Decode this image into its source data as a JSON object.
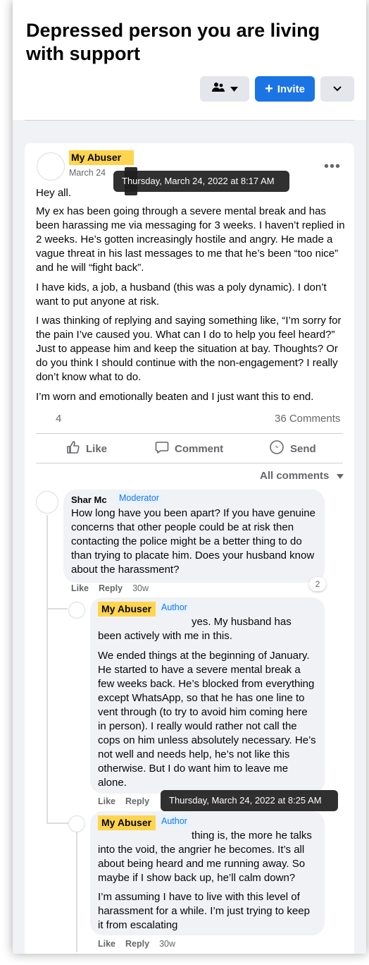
{
  "group": {
    "title": "Depressed person you are living with support",
    "invite_label": "Invite"
  },
  "post": {
    "author": "My Abuser",
    "date": "March 24",
    "timestamp_tooltip": "Thursday, March 24, 2022 at 8:17 AM",
    "paragraphs": [
      "Hey all.",
      "My ex has been going through a severe mental break and has been harassing me via messaging for 3 weeks. I haven’t replied in 2 weeks. He’s gotten increasingly hostile and angry. He made a vague threat in his last messages to me that he’s been “too nice” and he will “fight back”.",
      "I have kids, a job, a husband (this was a poly dynamic). I don’t want to put anyone at risk.",
      "I was thinking of replying and saying something like, “I’m sorry for the pain I’ve caused you. What can I do to help you feel heard?” Just to appease him and keep the situation at bay. Thoughts? Or do you think I should continue with the non-engagement? I really don’t know what to do.",
      "I’m worn and emotionally beaten and I just want this to end."
    ],
    "reaction_count": "4",
    "comments_count": "36 Comments",
    "actions": {
      "like": "Like",
      "comment": "Comment",
      "send": "Send"
    },
    "comments_filter": "All comments"
  },
  "comments": [
    {
      "name": "Shar Mc",
      "badge": "Moderator",
      "text": "How long have you been apart? If you have genuine concerns that other people could be at risk then contacting the police might be a better thing to do than trying to placate him. Does your husband know about the harassment?",
      "like": "Like",
      "reply": "Reply",
      "time": "30w",
      "reply_count": "2"
    },
    {
      "name": "My Abuser",
      "badge": "Author",
      "text1": "yes. My husband has been actively with me in this.",
      "text2": "We ended things at the beginning of January. He started to have a severe mental break a few weeks back. He’s blocked from everything except WhatsApp, so that he has one line to vent through (to try to avoid him coming here in person). I really would rather not call the cops on him unless absolutely necessary. He’s not well and needs help, he’s not like this otherwise. But I do want him to leave me alone.",
      "like": "Like",
      "reply": "Reply",
      "timestamp_tooltip": "Thursday, March 24, 2022 at 8:25 AM"
    },
    {
      "name": "My Abuser",
      "badge": "Author",
      "text1": "thing is, the more he talks into the void, the angrier he becomes. It’s all about being heard and me running away. So maybe if I show back up, he’ll calm down?",
      "text2": "I’m assuming I have to live with this level of harassment for a while. I’m just trying to keep it from escalating",
      "like": "Like",
      "reply": "Reply",
      "time": "30w"
    }
  ]
}
